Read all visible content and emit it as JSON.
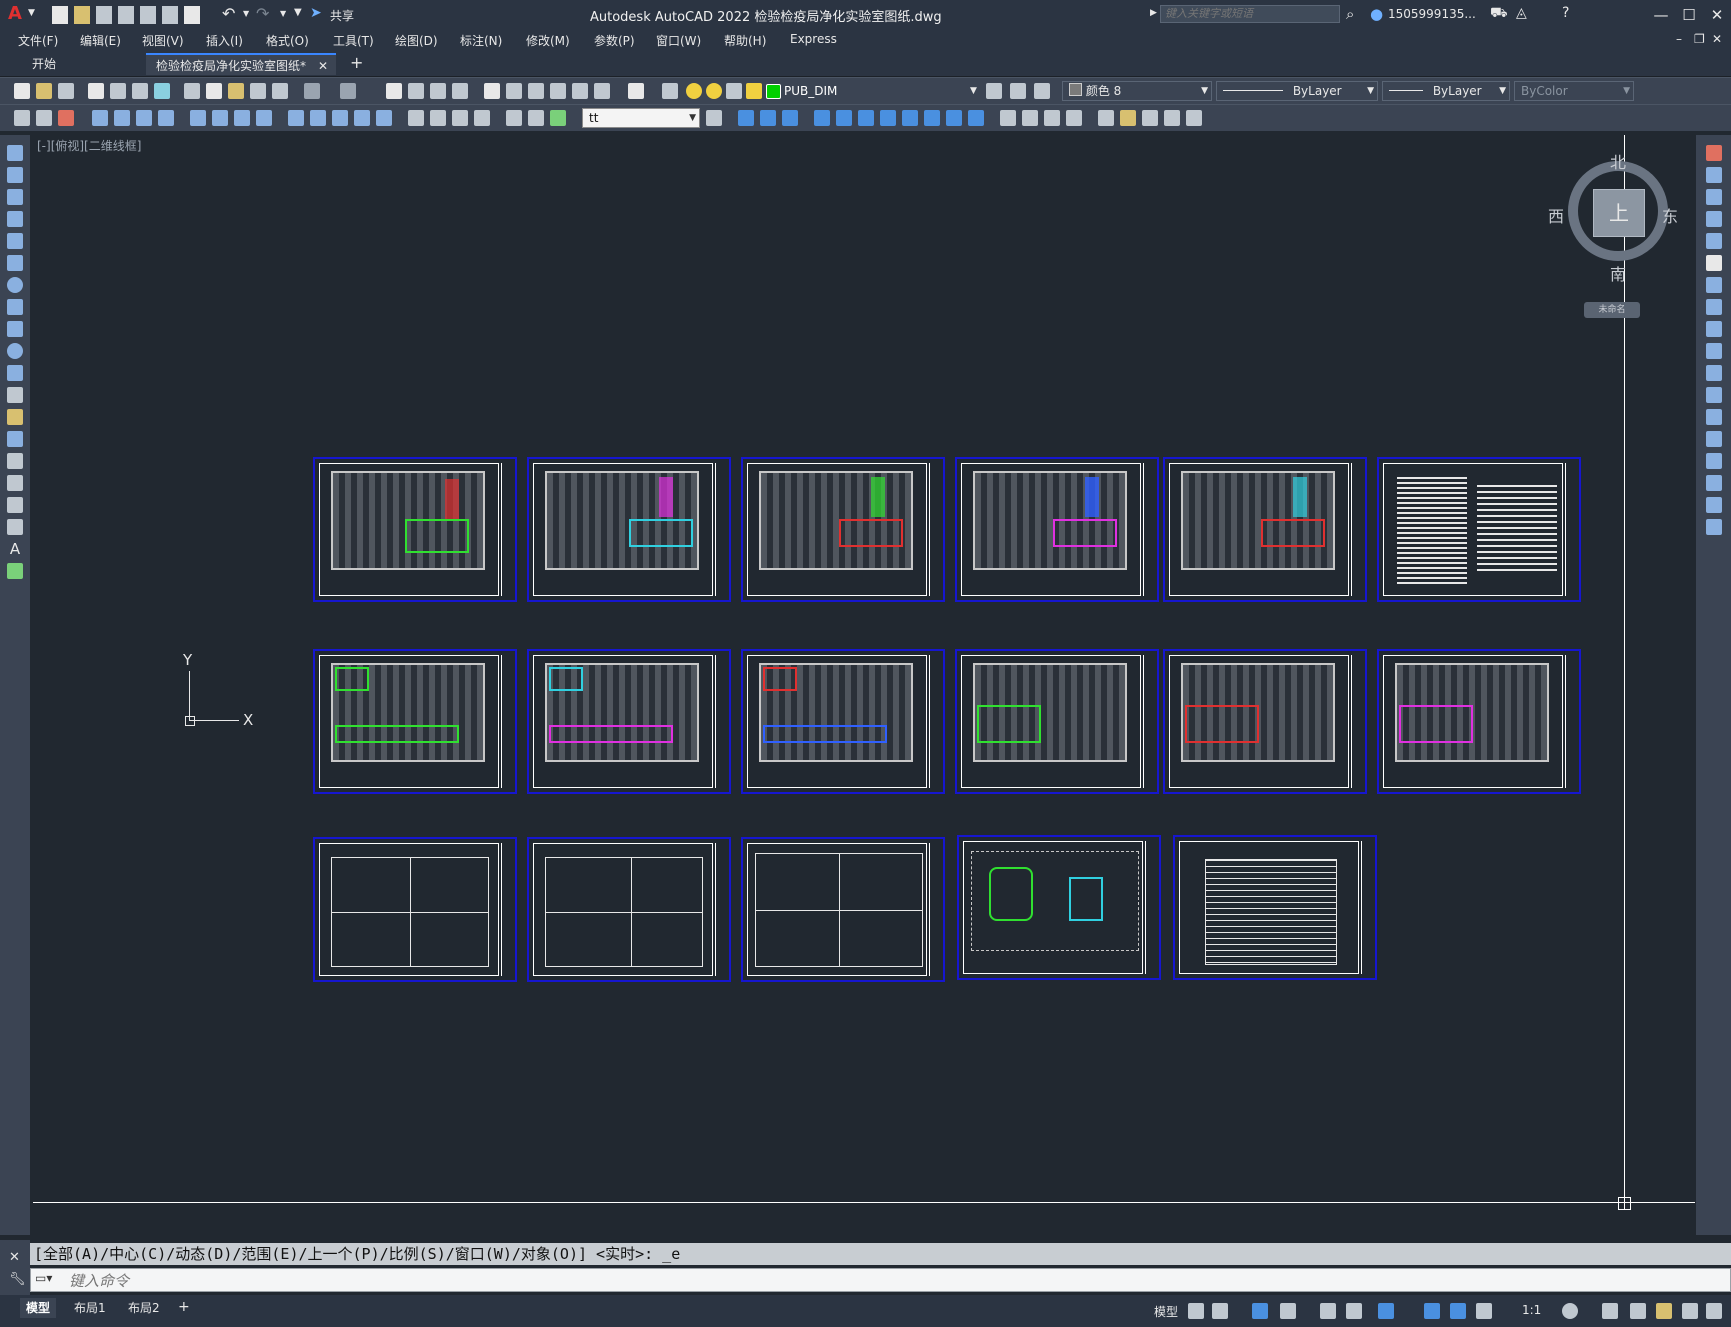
{
  "app": {
    "title": "Autodesk AutoCAD 2022    检验检疫局净化实验室图纸.dwg",
    "logo_letter": "A",
    "share_label": "共享",
    "search_placeholder": "键入关键字或短语",
    "user": "1505999135...",
    "accent_color": "#e03030"
  },
  "menus": [
    "文件(F)",
    "编辑(E)",
    "视图(V)",
    "插入(I)",
    "格式(O)",
    "工具(T)",
    "绘图(D)",
    "标注(N)",
    "修改(M)",
    "参数(P)",
    "窗口(W)",
    "帮助(H)",
    "Express"
  ],
  "tabs": [
    {
      "label": "开始"
    },
    {
      "label": "检验检疫局净化实验室图纸*"
    }
  ],
  "layer_toolbar": {
    "layer_name": "PUB_DIM",
    "layer_color": "#00d000",
    "color_value": "颜色 8",
    "linetype_value": "ByLayer",
    "lineweight_value": "ByLayer",
    "plotstyle_value": "ByColor"
  },
  "style_toolbar": {
    "dimstyle_value": "tt"
  },
  "canvas": {
    "viewport_label": "[-][俯视][二维线框]",
    "ucs_x": "X",
    "ucs_y": "Y",
    "viewcube": {
      "north": "北",
      "south": "南",
      "east": "东",
      "west": "西",
      "top": "上",
      "wcs": "未命名"
    }
  },
  "command": {
    "history": "[全部(A)/中心(C)/动态(D)/范围(E)/上一个(P)/比例(S)/窗口(W)/对象(O)] <实时>: _e",
    "placeholder": "键入命令"
  },
  "status": {
    "layouts": [
      "模型",
      "布局1",
      "布局2"
    ],
    "model_label": "模型",
    "scale": "1:1"
  }
}
